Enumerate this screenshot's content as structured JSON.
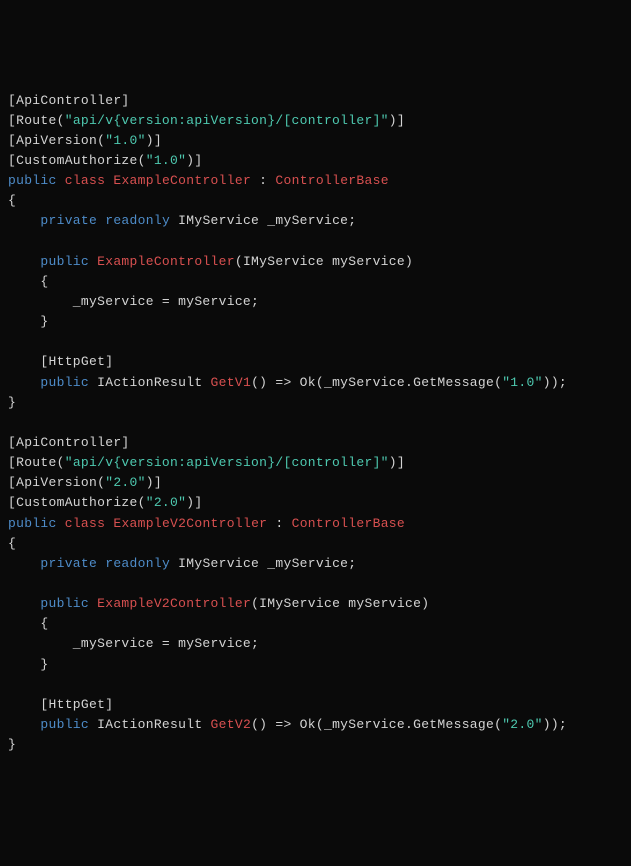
{
  "code": {
    "lines": [
      {
        "segments": [
          {
            "t": "[ApiController]",
            "c": "plain"
          }
        ]
      },
      {
        "segments": [
          {
            "t": "[Route(",
            "c": "plain"
          },
          {
            "t": "\"api/v{version:apiVersion}/[controller]\"",
            "c": "string"
          },
          {
            "t": ")]",
            "c": "plain"
          }
        ]
      },
      {
        "segments": [
          {
            "t": "[ApiVersion(",
            "c": "plain"
          },
          {
            "t": "\"1.0\"",
            "c": "string"
          },
          {
            "t": ")]",
            "c": "plain"
          }
        ]
      },
      {
        "segments": [
          {
            "t": "[CustomAuthorize(",
            "c": "plain"
          },
          {
            "t": "\"1.0\"",
            "c": "string"
          },
          {
            "t": ")]",
            "c": "plain"
          }
        ]
      },
      {
        "segments": [
          {
            "t": "public",
            "c": "keyword-public"
          },
          {
            "t": " ",
            "c": "plain"
          },
          {
            "t": "class",
            "c": "keyword-class"
          },
          {
            "t": " ",
            "c": "plain"
          },
          {
            "t": "ExampleController",
            "c": "classname"
          },
          {
            "t": " : ",
            "c": "plain"
          },
          {
            "t": "ControllerBase",
            "c": "classname"
          }
        ]
      },
      {
        "segments": [
          {
            "t": "{",
            "c": "brace"
          }
        ]
      },
      {
        "segments": [
          {
            "t": "    ",
            "c": "plain"
          },
          {
            "t": "private",
            "c": "keyword-private"
          },
          {
            "t": " ",
            "c": "plain"
          },
          {
            "t": "readonly",
            "c": "keyword-readonly"
          },
          {
            "t": " IMyService _myService;",
            "c": "plain"
          }
        ]
      },
      {
        "segments": [
          {
            "t": "",
            "c": "plain"
          }
        ]
      },
      {
        "segments": [
          {
            "t": "    ",
            "c": "plain"
          },
          {
            "t": "public",
            "c": "keyword-public"
          },
          {
            "t": " ",
            "c": "plain"
          },
          {
            "t": "ExampleController",
            "c": "classname"
          },
          {
            "t": "(IMyService myService)",
            "c": "plain"
          }
        ]
      },
      {
        "segments": [
          {
            "t": "    {",
            "c": "brace"
          }
        ]
      },
      {
        "segments": [
          {
            "t": "        _myService = myService;",
            "c": "plain"
          }
        ]
      },
      {
        "segments": [
          {
            "t": "    }",
            "c": "brace"
          }
        ]
      },
      {
        "segments": [
          {
            "t": "",
            "c": "plain"
          }
        ]
      },
      {
        "segments": [
          {
            "t": "    [HttpGet]",
            "c": "plain"
          }
        ]
      },
      {
        "segments": [
          {
            "t": "    ",
            "c": "plain"
          },
          {
            "t": "public",
            "c": "keyword-public"
          },
          {
            "t": " IActionResult ",
            "c": "plain"
          },
          {
            "t": "GetV1",
            "c": "method2"
          },
          {
            "t": "() => Ok(_myService.GetMessage(",
            "c": "plain"
          },
          {
            "t": "\"1.0\"",
            "c": "string"
          },
          {
            "t": "));",
            "c": "plain"
          }
        ]
      },
      {
        "segments": [
          {
            "t": "}",
            "c": "brace"
          }
        ]
      },
      {
        "segments": [
          {
            "t": "",
            "c": "plain"
          }
        ]
      },
      {
        "segments": [
          {
            "t": "[ApiController]",
            "c": "plain"
          }
        ]
      },
      {
        "segments": [
          {
            "t": "[Route(",
            "c": "plain"
          },
          {
            "t": "\"api/v{version:apiVersion}/[controller]\"",
            "c": "string"
          },
          {
            "t": ")]",
            "c": "plain"
          }
        ]
      },
      {
        "segments": [
          {
            "t": "[ApiVersion(",
            "c": "plain"
          },
          {
            "t": "\"2.0\"",
            "c": "string"
          },
          {
            "t": ")]",
            "c": "plain"
          }
        ]
      },
      {
        "segments": [
          {
            "t": "[CustomAuthorize(",
            "c": "plain"
          },
          {
            "t": "\"2.0\"",
            "c": "string"
          },
          {
            "t": ")]",
            "c": "plain"
          }
        ]
      },
      {
        "segments": [
          {
            "t": "public",
            "c": "keyword-public"
          },
          {
            "t": " ",
            "c": "plain"
          },
          {
            "t": "class",
            "c": "keyword-class"
          },
          {
            "t": " ",
            "c": "plain"
          },
          {
            "t": "ExampleV2Controller",
            "c": "classname"
          },
          {
            "t": " : ",
            "c": "plain"
          },
          {
            "t": "ControllerBase",
            "c": "classname"
          }
        ]
      },
      {
        "segments": [
          {
            "t": "{",
            "c": "brace"
          }
        ]
      },
      {
        "segments": [
          {
            "t": "    ",
            "c": "plain"
          },
          {
            "t": "private",
            "c": "keyword-private"
          },
          {
            "t": " ",
            "c": "plain"
          },
          {
            "t": "readonly",
            "c": "keyword-readonly"
          },
          {
            "t": " IMyService _myService;",
            "c": "plain"
          }
        ]
      },
      {
        "segments": [
          {
            "t": "",
            "c": "plain"
          }
        ]
      },
      {
        "segments": [
          {
            "t": "    ",
            "c": "plain"
          },
          {
            "t": "public",
            "c": "keyword-public"
          },
          {
            "t": " ",
            "c": "plain"
          },
          {
            "t": "ExampleV2Controller",
            "c": "classname"
          },
          {
            "t": "(IMyService myService)",
            "c": "plain"
          }
        ]
      },
      {
        "segments": [
          {
            "t": "    {",
            "c": "brace"
          }
        ]
      },
      {
        "segments": [
          {
            "t": "        _myService = myService;",
            "c": "plain"
          }
        ]
      },
      {
        "segments": [
          {
            "t": "    }",
            "c": "brace"
          }
        ]
      },
      {
        "segments": [
          {
            "t": "",
            "c": "plain"
          }
        ]
      },
      {
        "segments": [
          {
            "t": "    [HttpGet]",
            "c": "plain"
          }
        ]
      },
      {
        "segments": [
          {
            "t": "    ",
            "c": "plain"
          },
          {
            "t": "public",
            "c": "keyword-public"
          },
          {
            "t": " IActionResult ",
            "c": "plain"
          },
          {
            "t": "GetV2",
            "c": "method2"
          },
          {
            "t": "() => Ok(_myService.GetMessage(",
            "c": "plain"
          },
          {
            "t": "\"2.0\"",
            "c": "string"
          },
          {
            "t": "));",
            "c": "plain"
          }
        ]
      },
      {
        "segments": [
          {
            "t": "}",
            "c": "brace"
          }
        ]
      }
    ]
  }
}
